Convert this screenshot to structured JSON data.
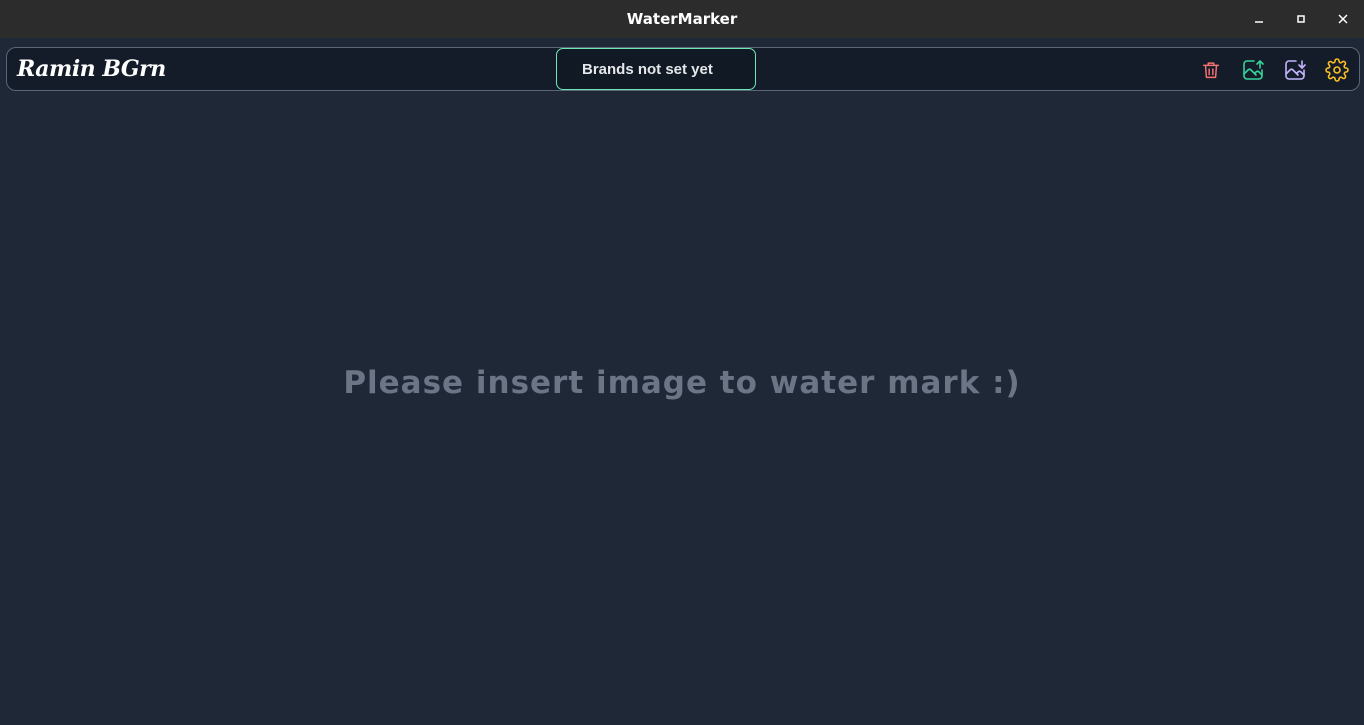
{
  "window": {
    "title": "WaterMarker",
    "controls": {
      "minimize": "minimize-icon",
      "maximize": "maximize-icon",
      "close": "close-icon"
    }
  },
  "appbar": {
    "brand": "Ramin BGrn",
    "brands_status": "Brands not set yet",
    "actions": [
      {
        "name": "delete",
        "icon": "trash-icon",
        "color": "#f87171"
      },
      {
        "name": "upload",
        "icon": "image-upload-icon",
        "color": "#34d399"
      },
      {
        "name": "download",
        "icon": "image-download-icon",
        "color": "#c4b5fd"
      },
      {
        "name": "settings",
        "icon": "gear-icon",
        "color": "#fbbf24"
      }
    ]
  },
  "main": {
    "placeholder": "Please insert image to water mark :)"
  },
  "colors": {
    "background": "#1e2837",
    "appbar": "#141c2a",
    "accent": "#6ee7b7",
    "placeholder_text": "#6b7585"
  }
}
